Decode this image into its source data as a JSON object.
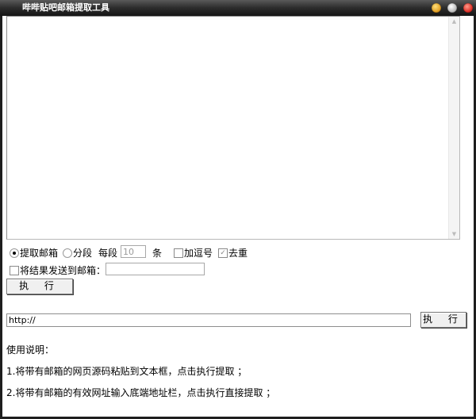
{
  "window": {
    "title": "哔哔贴吧邮箱提取工具"
  },
  "options": {
    "extract_email_label": "提取邮箱",
    "segment_label": "分段",
    "per_segment_label": "每段",
    "per_segment_value": "10",
    "per_segment_unit": "条",
    "add_comma_label": "加逗号",
    "dedupe_label": "去重",
    "send_to_email_label": "将结果发送到邮箱：",
    "send_to_email_value": ""
  },
  "execute_button_label": "执 行",
  "url_bar": {
    "value": "http://",
    "button_label": "执 行"
  },
  "instructions": {
    "heading": "使用说明：",
    "step1": "1.将带有邮箱的网页源码粘贴到文本框，点击执行提取 ；",
    "step2": "2.将带有邮箱的有效网址输入底端地址栏，点击执行直接提取 ；"
  }
}
